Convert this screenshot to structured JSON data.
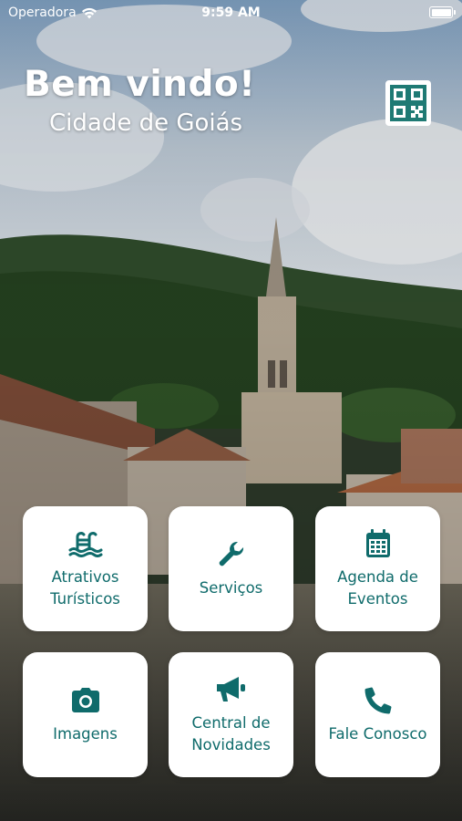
{
  "status_bar": {
    "carrier": "Operadora",
    "time": "9:59 AM"
  },
  "header": {
    "welcome": "Bem vindo!",
    "city": "Cidade de Goiás"
  },
  "menu": [
    {
      "label_lines": [
        "Atrativos",
        "Turísticos"
      ],
      "icon": "pool-icon"
    },
    {
      "label_lines": [
        "Serviços"
      ],
      "icon": "wrench-icon"
    },
    {
      "label_lines": [
        "Agenda de",
        "Eventos"
      ],
      "icon": "calendar-icon"
    },
    {
      "label_lines": [
        "Imagens"
      ],
      "icon": "camera-icon"
    },
    {
      "label_lines": [
        "Central de",
        "Novidades"
      ],
      "icon": "megaphone-icon"
    },
    {
      "label_lines": [
        "Fale Conosco"
      ],
      "icon": "phone-icon"
    }
  ],
  "colors": {
    "accent": "#0f6b6b",
    "tile_bg": "#ffffff"
  }
}
